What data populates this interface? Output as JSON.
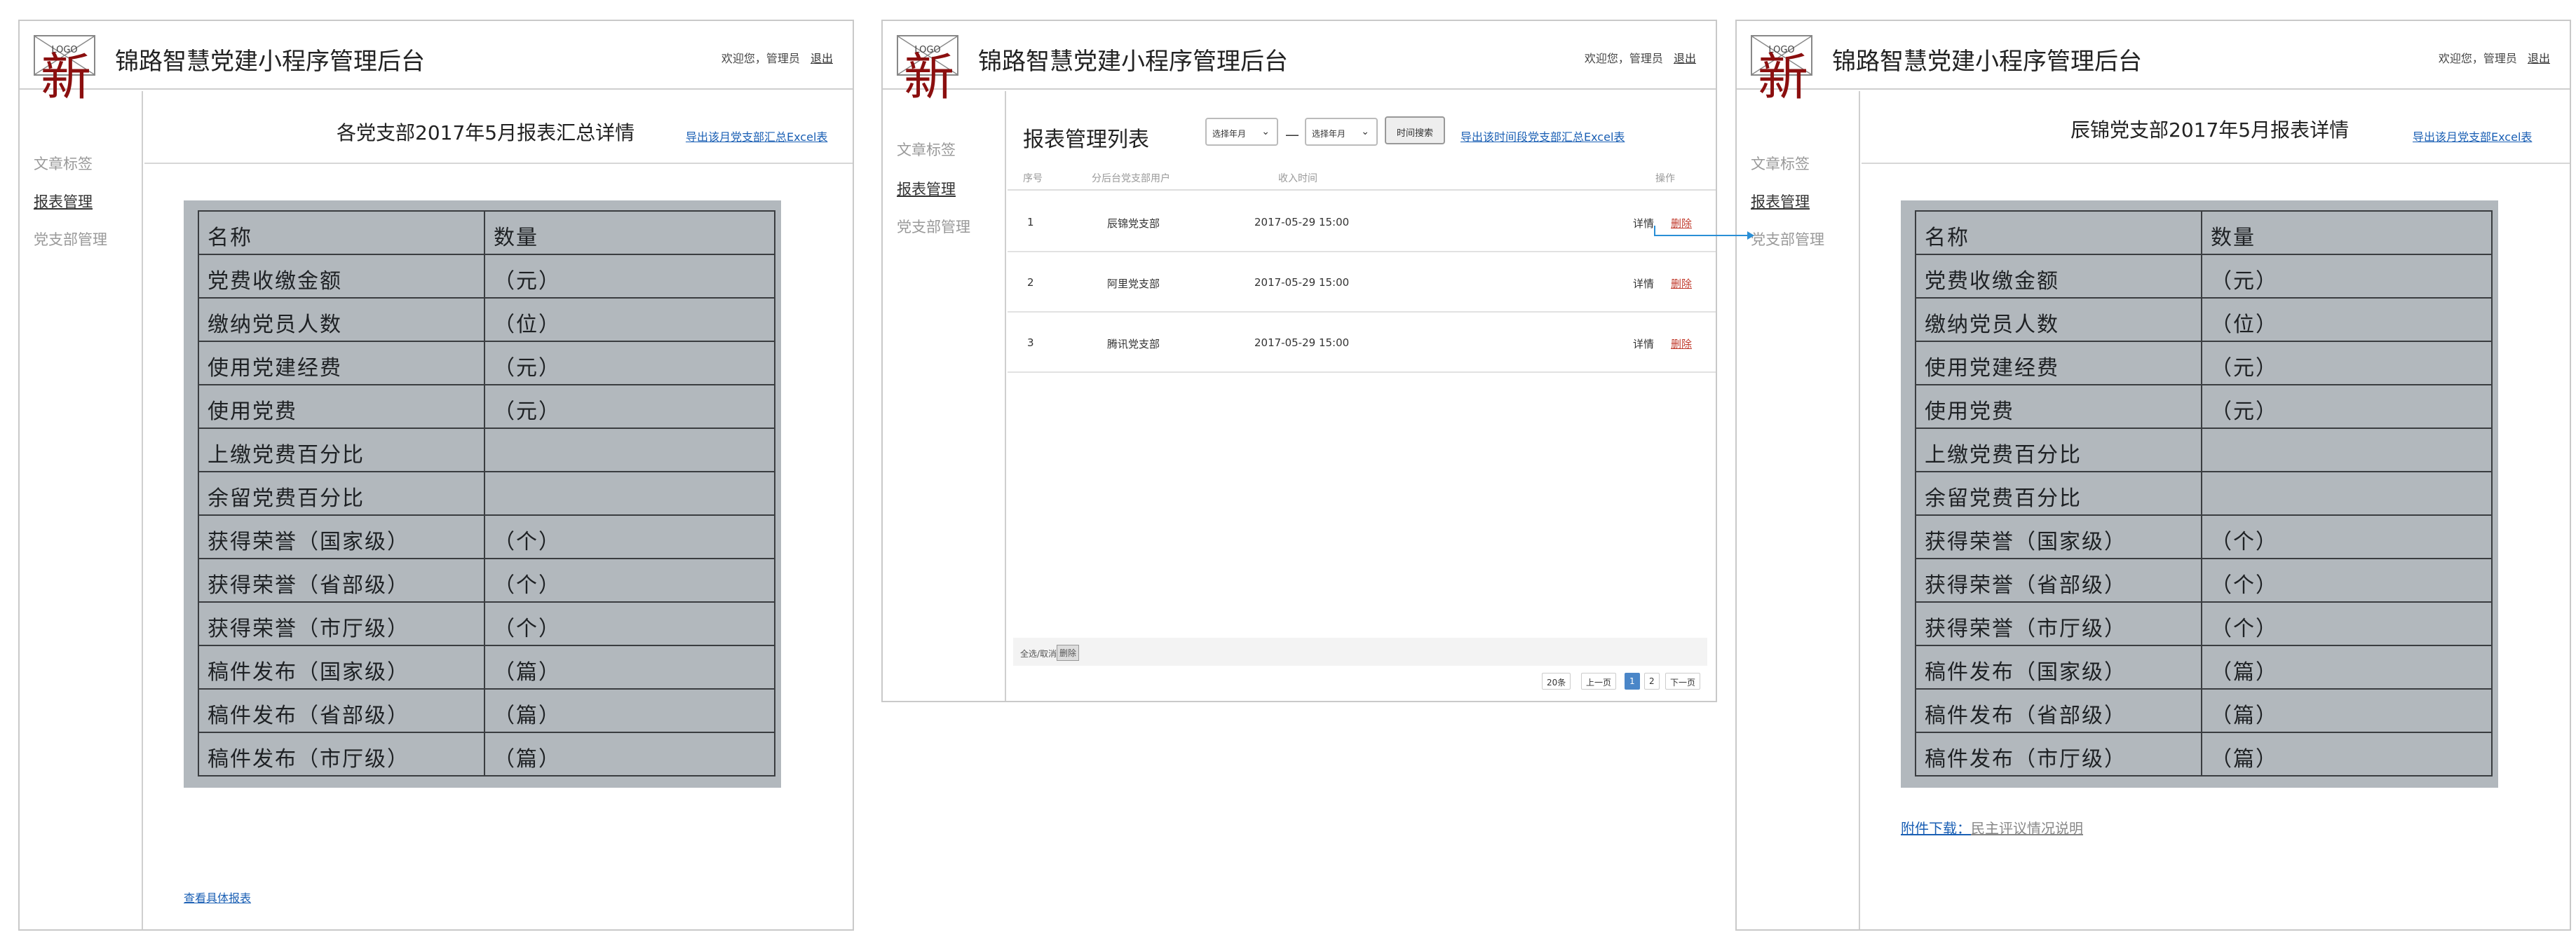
{
  "app": {
    "logo_text": "LOGO",
    "logo_badge": "新",
    "title": "锦路智慧党建小程序管理后台",
    "welcome": "欢迎您，管理员",
    "logout": "退出"
  },
  "sidebar": {
    "items": [
      "文章标签",
      "报表管理",
      "党支部管理"
    ],
    "active": "报表管理"
  },
  "panel_summary": {
    "title": "各党支部2017年5月报表汇总详情",
    "export": "导出该月党支部汇总Excel表",
    "view_link": "查看具体报表"
  },
  "panel_list": {
    "title": "报表管理列表",
    "select_month_1": "选择年月",
    "dash": "—",
    "select_month_2": "选择年月",
    "search_button": "时间搜索",
    "export": "导出该时间段党支部汇总Excel表",
    "columns": [
      "序号",
      "分后台党支部用户",
      "收入时间",
      "操作"
    ],
    "rows": [
      {
        "no": "1",
        "branch": "辰锦党支部",
        "time": "2017-05-29  15:00",
        "detail": "详情",
        "delete": "删除"
      },
      {
        "no": "2",
        "branch": "阿里党支部",
        "time": "2017-05-29  15:00",
        "detail": "详情",
        "delete": "删除"
      },
      {
        "no": "3",
        "branch": "腾讯党支部",
        "time": "2017-05-29  15:00",
        "detail": "详情",
        "delete": "删除"
      }
    ],
    "select_all": "全选/取消",
    "bulk_delete": "删除",
    "pager": {
      "count": "20条",
      "prev": "上一页",
      "page1": "1",
      "page2": "2",
      "next": "下一页"
    }
  },
  "panel_detail": {
    "title": "辰锦党支部2017年5月报表详情",
    "export": "导出该月党支部Excel表",
    "attach_label": "附件下载：",
    "attach_file": "民主评议情况说明"
  },
  "report_table": {
    "header": [
      "名称",
      "数量"
    ],
    "rows": [
      [
        "党费收缴金额",
        "（元）"
      ],
      [
        "缴纳党员人数",
        "（位）"
      ],
      [
        "使用党建经费",
        "（元）"
      ],
      [
        "使用党费",
        "（元）"
      ],
      [
        "上缴党费百分比",
        ""
      ],
      [
        "余留党费百分比",
        ""
      ],
      [
        "获得荣誉（国家级）",
        "（个）"
      ],
      [
        "获得荣誉（省部级）",
        "（个）"
      ],
      [
        "获得荣誉（市厅级）",
        "（个）"
      ],
      [
        "稿件发布（国家级）",
        "（篇）"
      ],
      [
        "稿件发布（省部级）",
        "（篇）"
      ],
      [
        "稿件发布（市厅级）",
        "（篇）"
      ]
    ]
  },
  "colors": {
    "accent_link": "#1a5fb4",
    "delete": "#c0392b",
    "badge": "#8b0f0f"
  }
}
